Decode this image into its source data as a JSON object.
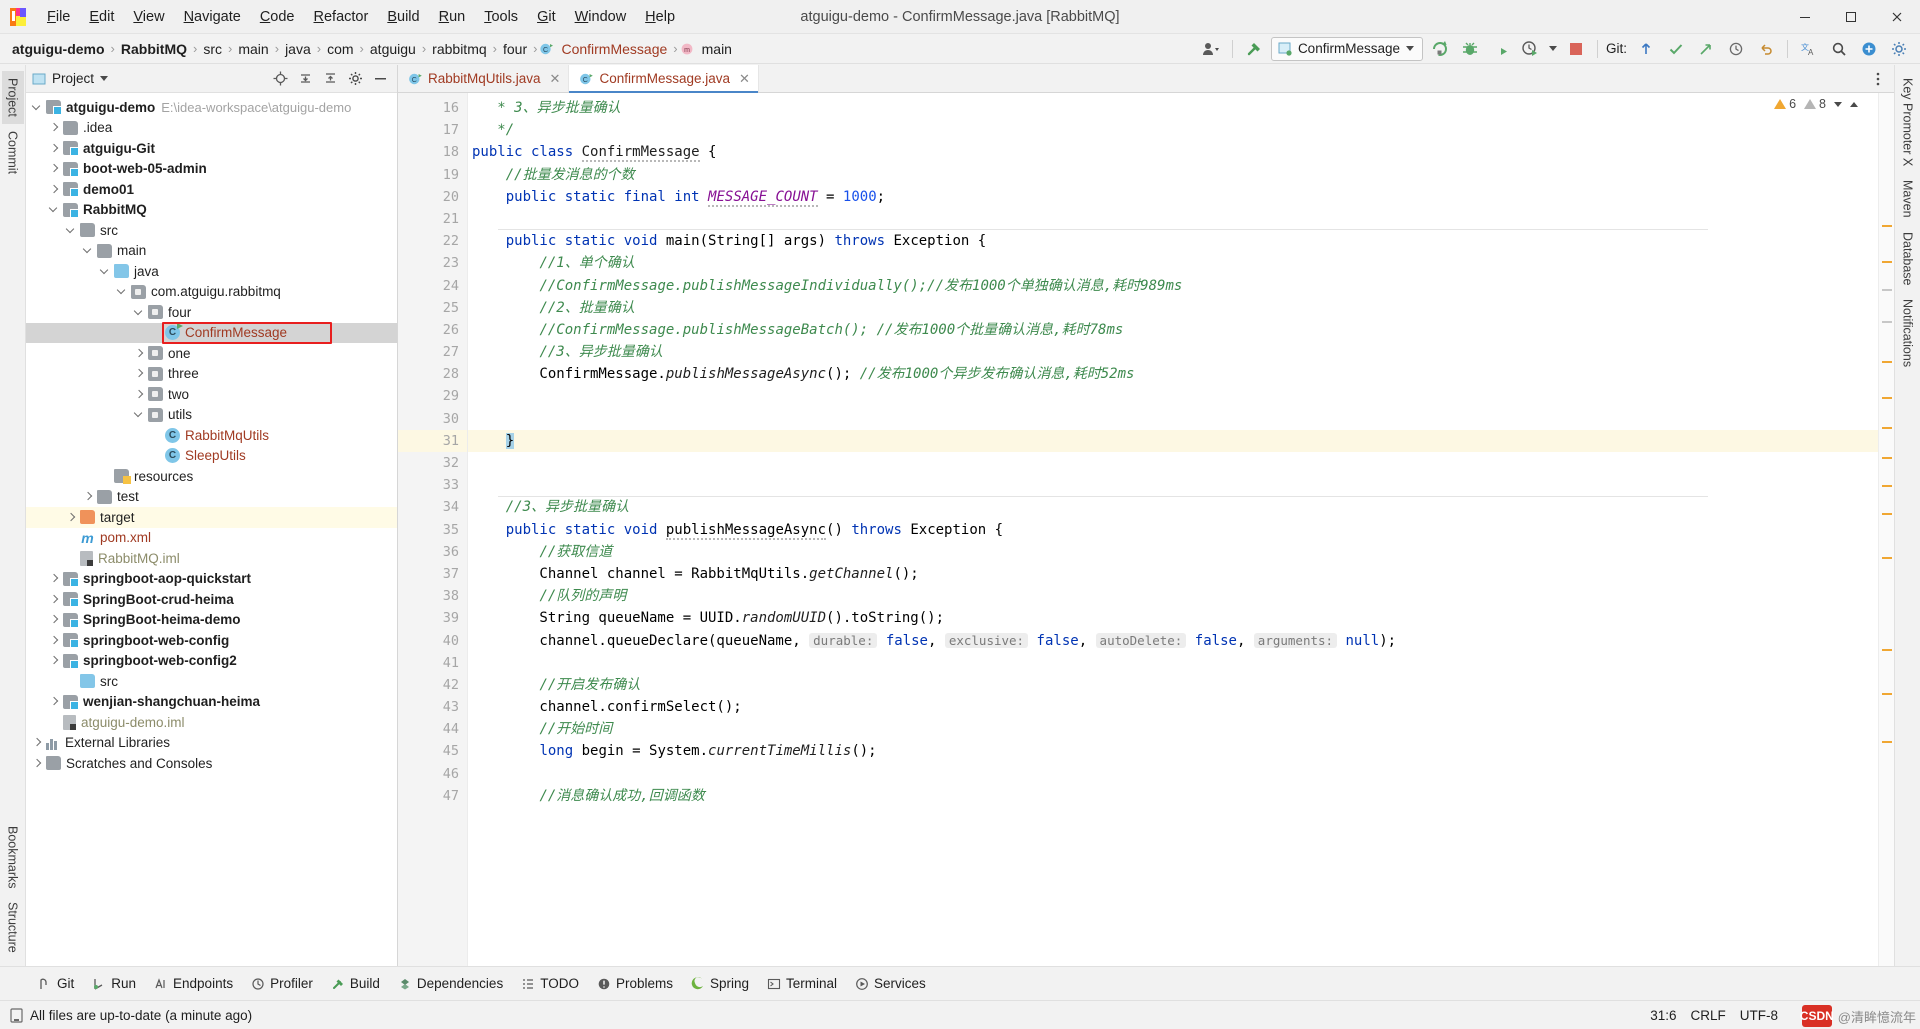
{
  "window": {
    "title": "atguigu-demo - ConfirmMessage.java [RabbitMQ]",
    "minimize": "─",
    "maximize": "❐",
    "close": "✕"
  },
  "menu": [
    {
      "label": "File"
    },
    {
      "label": "Edit"
    },
    {
      "label": "View"
    },
    {
      "label": "Navigate"
    },
    {
      "label": "Code"
    },
    {
      "label": "Refactor"
    },
    {
      "label": "Build"
    },
    {
      "label": "Run"
    },
    {
      "label": "Tools"
    },
    {
      "label": "Git"
    },
    {
      "label": "Window"
    },
    {
      "label": "Help"
    }
  ],
  "breadcrumbs": [
    {
      "label": "atguigu-demo",
      "bold": true,
      "icon": "none"
    },
    {
      "label": "RabbitMQ",
      "bold": true,
      "icon": "none"
    },
    {
      "label": "src",
      "bold": false,
      "icon": "none"
    },
    {
      "label": "main",
      "bold": false,
      "icon": "none"
    },
    {
      "label": "java",
      "bold": false,
      "icon": "none"
    },
    {
      "label": "com",
      "bold": false,
      "icon": "none"
    },
    {
      "label": "atguigu",
      "bold": false,
      "icon": "none"
    },
    {
      "label": "rabbitmq",
      "bold": false,
      "icon": "none"
    },
    {
      "label": "four",
      "bold": false,
      "icon": "none"
    },
    {
      "label": "ConfirmMessage",
      "bold": false,
      "icon": "class"
    },
    {
      "label": "main",
      "bold": false,
      "icon": "method"
    }
  ],
  "toolbar": {
    "run_config": "ConfirmMessage",
    "git_label": "Git:",
    "icons": [
      "account-icon",
      "build-hammer-icon",
      "run-icon",
      "debug-icon",
      "run-with-coverage-icon",
      "profiler-icon",
      "stop-icon",
      "git-update-icon",
      "git-commit-icon",
      "git-push-icon",
      "git-history-icon",
      "undo-icon",
      "translate-icon",
      "search-icon",
      "plugin-icon",
      "settings-icon"
    ]
  },
  "project_panel": {
    "title": "Project",
    "header_icons": [
      "locate-icon",
      "expand-all-icon",
      "collapse-all-icon",
      "settings-icon",
      "hide-icon"
    ],
    "tree": [
      {
        "depth": 0,
        "arrow": "expanded",
        "icon": "folder-module",
        "label": "atguigu-demo",
        "bold": true,
        "path": "E:\\idea-workspace\\atguigu-demo",
        "state": "normal"
      },
      {
        "depth": 1,
        "arrow": "collapsed",
        "icon": "folder-gray",
        "label": ".idea",
        "bold": false,
        "path": "",
        "state": "normal"
      },
      {
        "depth": 1,
        "arrow": "collapsed",
        "icon": "folder-module",
        "label": "atguigu-Git",
        "bold": true,
        "path": "",
        "state": "normal"
      },
      {
        "depth": 1,
        "arrow": "collapsed",
        "icon": "folder-module",
        "label": "boot-web-05-admin",
        "bold": true,
        "path": "",
        "state": "normal"
      },
      {
        "depth": 1,
        "arrow": "collapsed",
        "icon": "folder-module",
        "label": "demo01",
        "bold": true,
        "path": "",
        "state": "normal"
      },
      {
        "depth": 1,
        "arrow": "expanded",
        "icon": "folder-module",
        "label": "RabbitMQ",
        "bold": true,
        "path": "",
        "state": "normal"
      },
      {
        "depth": 2,
        "arrow": "expanded",
        "icon": "folder-gray",
        "label": "src",
        "bold": false,
        "path": "",
        "state": "normal"
      },
      {
        "depth": 3,
        "arrow": "expanded",
        "icon": "folder-gray",
        "label": "main",
        "bold": false,
        "path": "",
        "state": "normal"
      },
      {
        "depth": 4,
        "arrow": "expanded",
        "icon": "folder-blue",
        "label": "java",
        "bold": false,
        "path": "",
        "state": "normal"
      },
      {
        "depth": 5,
        "arrow": "expanded",
        "icon": "folder-pkg",
        "label": "com.atguigu.rabbitmq",
        "bold": false,
        "path": "",
        "state": "normal"
      },
      {
        "depth": 6,
        "arrow": "expanded",
        "icon": "folder-pkg",
        "label": "four",
        "bold": false,
        "path": "",
        "state": "normal"
      },
      {
        "depth": 7,
        "arrow": "none",
        "icon": "class-runnable",
        "label": "ConfirmMessage",
        "bold": false,
        "path": "",
        "state": "selected"
      },
      {
        "depth": 6,
        "arrow": "collapsed",
        "icon": "folder-pkg",
        "label": "one",
        "bold": false,
        "path": "",
        "state": "normal"
      },
      {
        "depth": 6,
        "arrow": "collapsed",
        "icon": "folder-pkg",
        "label": "three",
        "bold": false,
        "path": "",
        "state": "normal"
      },
      {
        "depth": 6,
        "arrow": "collapsed",
        "icon": "folder-pkg",
        "label": "two",
        "bold": false,
        "path": "",
        "state": "normal"
      },
      {
        "depth": 6,
        "arrow": "expanded",
        "icon": "folder-pkg",
        "label": "utils",
        "bold": false,
        "path": "",
        "state": "normal"
      },
      {
        "depth": 7,
        "arrow": "none",
        "icon": "class",
        "label": "RabbitMqUtils",
        "bold": false,
        "path": "",
        "state": "normal"
      },
      {
        "depth": 7,
        "arrow": "none",
        "icon": "class",
        "label": "SleepUtils",
        "bold": false,
        "path": "",
        "state": "normal"
      },
      {
        "depth": 4,
        "arrow": "none",
        "icon": "folder-resources",
        "label": "resources",
        "bold": false,
        "path": "",
        "state": "normal"
      },
      {
        "depth": 3,
        "arrow": "collapsed",
        "icon": "folder-gray",
        "label": "test",
        "bold": false,
        "path": "",
        "state": "normal"
      },
      {
        "depth": 2,
        "arrow": "collapsed",
        "icon": "folder-orange",
        "label": "target",
        "bold": false,
        "path": "",
        "state": "highlight"
      },
      {
        "depth": 2,
        "arrow": "none",
        "icon": "maven",
        "label": "pom.xml",
        "bold": false,
        "path": "",
        "state": "normal"
      },
      {
        "depth": 2,
        "arrow": "none",
        "icon": "iml",
        "label": "RabbitMQ.iml",
        "bold": false,
        "path": "",
        "state": "normal"
      },
      {
        "depth": 1,
        "arrow": "collapsed",
        "icon": "folder-module",
        "label": "springboot-aop-quickstart",
        "bold": true,
        "path": "",
        "state": "normal"
      },
      {
        "depth": 1,
        "arrow": "collapsed",
        "icon": "folder-module",
        "label": "SpringBoot-crud-heima",
        "bold": true,
        "path": "",
        "state": "normal"
      },
      {
        "depth": 1,
        "arrow": "collapsed",
        "icon": "folder-module",
        "label": "SpringBoot-heima-demo",
        "bold": true,
        "path": "",
        "state": "normal"
      },
      {
        "depth": 1,
        "arrow": "collapsed",
        "icon": "folder-module",
        "label": "springboot-web-config",
        "bold": true,
        "path": "",
        "state": "normal"
      },
      {
        "depth": 1,
        "arrow": "collapsed",
        "icon": "folder-module",
        "label": "springboot-web-config2",
        "bold": true,
        "path": "",
        "state": "normal"
      },
      {
        "depth": 2,
        "arrow": "none",
        "icon": "folder-blue",
        "label": "src",
        "bold": false,
        "path": "",
        "state": "normal"
      },
      {
        "depth": 1,
        "arrow": "collapsed",
        "icon": "folder-module",
        "label": "wenjian-shangchuan-heima",
        "bold": true,
        "path": "",
        "state": "normal"
      },
      {
        "depth": 1,
        "arrow": "none",
        "icon": "iml",
        "label": "atguigu-demo.iml",
        "bold": false,
        "path": "",
        "state": "normal"
      },
      {
        "depth": 0,
        "arrow": "collapsed",
        "icon": "library",
        "label": "External Libraries",
        "bold": false,
        "path": "",
        "state": "normal"
      },
      {
        "depth": 0,
        "arrow": "collapsed",
        "icon": "scratch",
        "label": "Scratches and Consoles",
        "bold": false,
        "path": "",
        "state": "normal"
      }
    ]
  },
  "left_rail": [
    {
      "label": "Project",
      "active": true
    },
    {
      "label": "Commit",
      "active": false
    }
  ],
  "left_rail_bottom": [
    {
      "label": "Bookmarks",
      "active": false
    },
    {
      "label": "Structure",
      "active": false
    }
  ],
  "right_rail": [
    {
      "label": "Key Promoter X"
    },
    {
      "label": "Maven"
    },
    {
      "label": "Database"
    },
    {
      "label": "Notifications"
    }
  ],
  "tabs": [
    {
      "label": "RabbitMqUtils.java",
      "active": false,
      "close": "✕"
    },
    {
      "label": "ConfirmMessage.java",
      "active": true,
      "close": "✕"
    }
  ],
  "inspection": {
    "warnings": "6",
    "weak_warnings": "8"
  },
  "code": {
    "first_line_number": 16,
    "lines": [
      {
        "n": 16,
        "runnable": false,
        "hl": false,
        "fold": "end",
        "html": "  <span class='cmt'> * 3、异步批量确认</span>"
      },
      {
        "n": 17,
        "runnable": false,
        "hl": false,
        "fold": "endmark",
        "html": "  <span class='cmt'> */</span>"
      },
      {
        "n": 18,
        "runnable": true,
        "hl": false,
        "fold": "none",
        "html": "<span class='kw'>public class</span> <span class='cls squiggle'>ConfirmMessage</span> {"
      },
      {
        "n": 19,
        "runnable": false,
        "hl": false,
        "fold": "none",
        "html": "    <span class='cmt'>//批量发消息的个数</span>"
      },
      {
        "n": 20,
        "runnable": false,
        "hl": false,
        "fold": "none",
        "html": "    <span class='kw'>public static final int</span> <span class='fld squiggle'>MESSAGE_COUNT</span> = <span class='num'>1000</span>;"
      },
      {
        "n": 21,
        "runnable": false,
        "hl": false,
        "fold": "none",
        "html": ""
      },
      {
        "n": 22,
        "runnable": true,
        "hl": false,
        "fold": "start",
        "html": "    <span class='kw'>public static void</span> main(String[] args) <span class='kw'>throws</span> Exception {"
      },
      {
        "n": 23,
        "runnable": false,
        "hl": false,
        "fold": "none",
        "html": "        <span class='cmt'>//1、单个确认</span>"
      },
      {
        "n": 24,
        "runnable": false,
        "hl": false,
        "fold": "none",
        "html": "        <span class='cmt'>//ConfirmMessage.publishMessageIndividually();//发布1000个单独确认消息,耗时989ms</span>"
      },
      {
        "n": 25,
        "runnable": false,
        "hl": false,
        "fold": "none",
        "html": "        <span class='cmt'>//2、批量确认</span>"
      },
      {
        "n": 26,
        "runnable": false,
        "hl": false,
        "fold": "none",
        "html": "        <span class='cmt'>//ConfirmMessage.publishMessageBatch(); //发布1000个批量确认消息,耗时78ms</span>"
      },
      {
        "n": 27,
        "runnable": false,
        "hl": false,
        "fold": "none",
        "html": "        <span class='cmt'>//3、异步批量确认</span>"
      },
      {
        "n": 28,
        "runnable": false,
        "hl": false,
        "fold": "none",
        "html": "        ConfirmMessage.<span class='mth'>publishMessageAsync</span>(); <span class='cmt'>//发布1000个异步发布确认消息,耗时52ms</span>"
      },
      {
        "n": 29,
        "runnable": false,
        "hl": false,
        "fold": "none",
        "html": ""
      },
      {
        "n": 30,
        "runnable": false,
        "hl": false,
        "fold": "none",
        "html": ""
      },
      {
        "n": 31,
        "runnable": false,
        "hl": true,
        "fold": "endmark",
        "html": "    <span class='sel'>}</span>"
      },
      {
        "n": 32,
        "runnable": false,
        "hl": false,
        "fold": "none",
        "html": ""
      },
      {
        "n": 33,
        "runnable": false,
        "hl": false,
        "fold": "none",
        "html": ""
      },
      {
        "n": 34,
        "runnable": false,
        "hl": false,
        "fold": "none",
        "html": "    <span class='cmt'>//3、异步批量确认</span>"
      },
      {
        "n": 35,
        "runnable": false,
        "hl": false,
        "fold": "start",
        "html": "    <span class='kw'>public static void</span> <span class='squiggle'>publishMessageAsync</span>() <span class='kw'>throws</span> Exception {"
      },
      {
        "n": 36,
        "runnable": false,
        "hl": false,
        "fold": "none",
        "html": "        <span class='cmt'>//获取信道</span>"
      },
      {
        "n": 37,
        "runnable": false,
        "hl": false,
        "fold": "none",
        "html": "        Channel channel = RabbitMqUtils.<span class='mth'>getChannel</span>();"
      },
      {
        "n": 38,
        "runnable": false,
        "hl": false,
        "fold": "none",
        "html": "        <span class='cmt'>//队列的声明</span>"
      },
      {
        "n": 39,
        "runnable": false,
        "hl": false,
        "fold": "none",
        "html": "        String queueName = UUID.<span class='mth'>randomUUID</span>().toString();"
      },
      {
        "n": 40,
        "runnable": false,
        "hl": false,
        "fold": "none",
        "html": "        channel.queueDeclare(queueName, <span class='hint'>durable:</span> <span class='kw'>false</span>, <span class='hint'>exclusive:</span> <span class='kw'>false</span>, <span class='hint'>autoDelete:</span> <span class='kw'>false</span>, <span class='hint'>arguments:</span> <span class='kw'>null</span>);"
      },
      {
        "n": 41,
        "runnable": false,
        "hl": false,
        "fold": "none",
        "html": ""
      },
      {
        "n": 42,
        "runnable": false,
        "hl": false,
        "fold": "none",
        "html": "        <span class='cmt'>//开启发布确认</span>"
      },
      {
        "n": 43,
        "runnable": false,
        "hl": false,
        "fold": "none",
        "html": "        channel.confirmSelect();"
      },
      {
        "n": 44,
        "runnable": false,
        "hl": false,
        "fold": "none",
        "html": "        <span class='cmt'>//开始时间</span>"
      },
      {
        "n": 45,
        "runnable": false,
        "hl": false,
        "fold": "none",
        "html": "        <span class='kw'>long</span> begin = System.<span class='mth'>currentTimeMillis</span>();"
      },
      {
        "n": 46,
        "runnable": false,
        "hl": false,
        "fold": "none",
        "html": ""
      },
      {
        "n": 47,
        "runnable": false,
        "hl": false,
        "fold": "none",
        "html": "        <span class='cmt'>//消息确认成功,回调函数</span>"
      }
    ]
  },
  "toolwindows": [
    {
      "label": "Git",
      "icon": "git-icon"
    },
    {
      "label": "Run",
      "icon": "run-icon"
    },
    {
      "label": "Endpoints",
      "icon": "endpoints-icon"
    },
    {
      "label": "Profiler",
      "icon": "profiler-icon"
    },
    {
      "label": "Build",
      "icon": "build-icon"
    },
    {
      "label": "Dependencies",
      "icon": "dependencies-icon"
    },
    {
      "label": "TODO",
      "icon": "todo-icon"
    },
    {
      "label": "Problems",
      "icon": "problems-icon"
    },
    {
      "label": "Spring",
      "icon": "spring-icon"
    },
    {
      "label": "Terminal",
      "icon": "terminal-icon"
    },
    {
      "label": "Services",
      "icon": "services-icon"
    }
  ],
  "statusbar": {
    "message": "All files are up-to-date (a minute ago)",
    "caret": "31:6",
    "line_sep": "CRLF",
    "encoding": "UTF-8"
  },
  "watermark": {
    "logo": "CSDN",
    "text": "@清眸憶流年"
  },
  "colors": {
    "accent": "#4a86c8",
    "selection": "#d4d4d4",
    "keyword": "#0033b3",
    "comment": "#3e8a4e",
    "number": "#1750eb",
    "field": "#871094",
    "annotation_red": "#e81f1f",
    "panel_bg": "#f2f2f2",
    "editor_bg": "#ffffff"
  }
}
